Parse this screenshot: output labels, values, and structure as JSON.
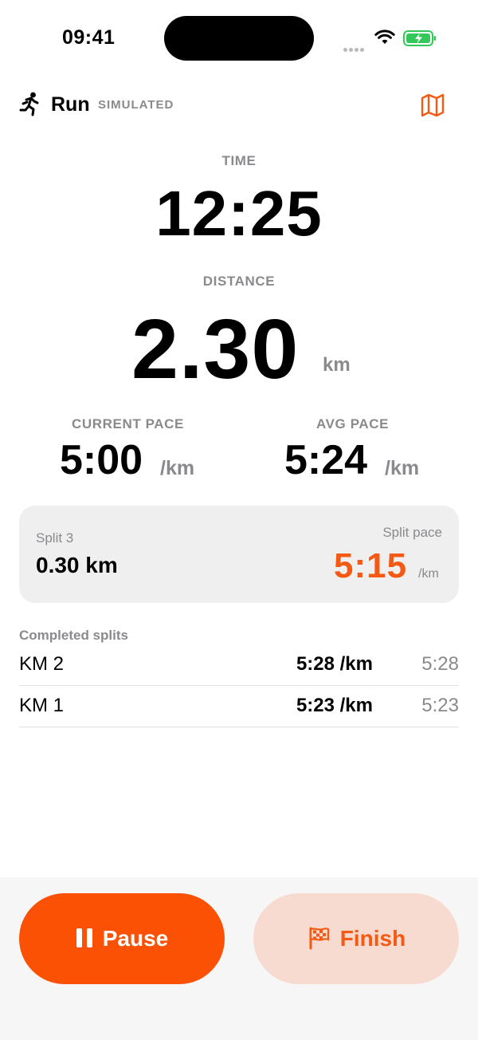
{
  "status_bar": {
    "time": "09:41"
  },
  "header": {
    "title": "Run",
    "mode": "SIMULATED"
  },
  "time": {
    "label": "TIME",
    "value": "12:25"
  },
  "distance": {
    "label": "DISTANCE",
    "value": "2.30",
    "unit": "km"
  },
  "current_pace": {
    "label": "CURRENT PACE",
    "value": "5:00",
    "unit": "/km"
  },
  "avg_pace": {
    "label": "AVG PACE",
    "value": "5:24",
    "unit": "/km"
  },
  "split": {
    "name": "Split 3",
    "distance": "0.30 km",
    "pace_label": "Split pace",
    "pace": "5:15",
    "pace_unit": "/km"
  },
  "completed_splits": {
    "title": "Completed splits",
    "rows": [
      {
        "km": "KM 2",
        "pace": "5:28 /km",
        "time": "5:28"
      },
      {
        "km": "KM 1",
        "pace": "5:23 /km",
        "time": "5:23"
      }
    ]
  },
  "buttons": {
    "pause": "Pause",
    "finish": "Finish"
  },
  "colors": {
    "accent": "#fb5105",
    "accent_light": "#f8dbd0",
    "muted": "#8a8a8e",
    "battery": "#34c759"
  },
  "icons": [
    "runner-icon",
    "map-icon",
    "pause-icon",
    "checkered-flag-icon",
    "wifi-icon",
    "battery-icon"
  ]
}
